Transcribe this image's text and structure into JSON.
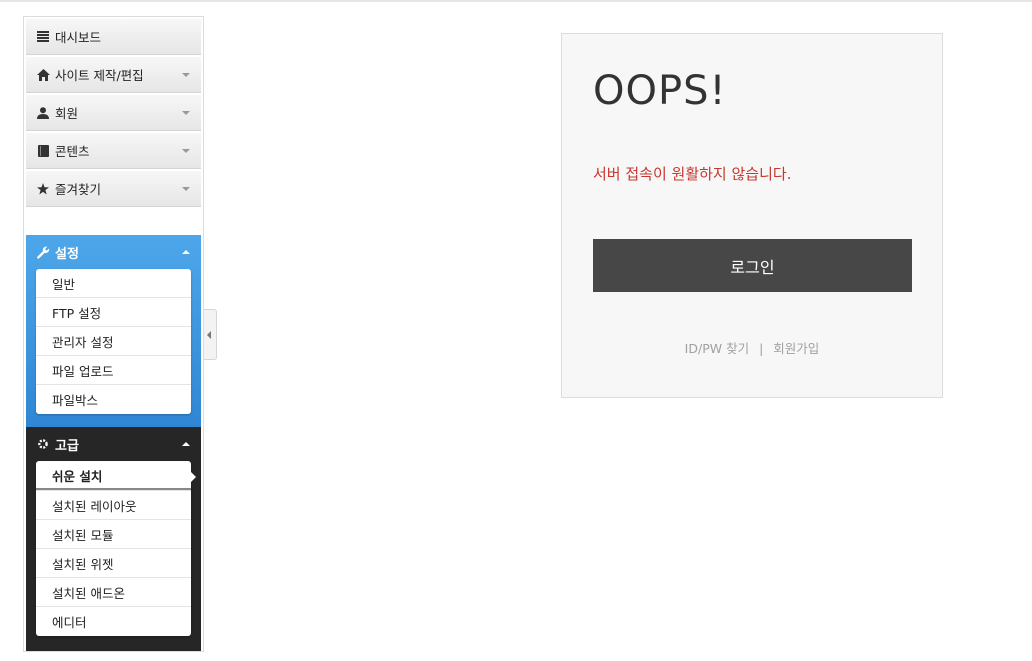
{
  "sidebar": {
    "nav": [
      {
        "label": "대시보드",
        "icon": "list-icon",
        "has_caret": false
      },
      {
        "label": "사이트 제작/편집",
        "icon": "home-icon",
        "has_caret": true
      },
      {
        "label": "회원",
        "icon": "user-icon",
        "has_caret": true
      },
      {
        "label": "콘텐츠",
        "icon": "book-icon",
        "has_caret": true
      },
      {
        "label": "즐겨찾기",
        "icon": "star-icon",
        "has_caret": true
      }
    ],
    "settings": {
      "title": "설정",
      "icon": "wrench-icon",
      "items": [
        "일반",
        "FTP 설정",
        "관리자 설정",
        "파일 업로드",
        "파일박스"
      ]
    },
    "advanced": {
      "title": "고급",
      "icon": "gear-icon",
      "active_item": "쉬운 설치",
      "items": [
        "쉬운 설치",
        "설치된 레이아웃",
        "설치된 모듈",
        "설치된 위젯",
        "설치된 애드온",
        "에디터"
      ]
    }
  },
  "card": {
    "title": "OOPS!",
    "message": "서버 접속이 원활하지 않습니다.",
    "login_label": "로그인",
    "find_label": "ID/PW 찾기",
    "separator": "|",
    "signup_label": "회원가입"
  },
  "colors": {
    "error": "#c7372f",
    "settings_blue": "#3a93dc",
    "advanced_dark": "#262626",
    "button": "#474747"
  }
}
